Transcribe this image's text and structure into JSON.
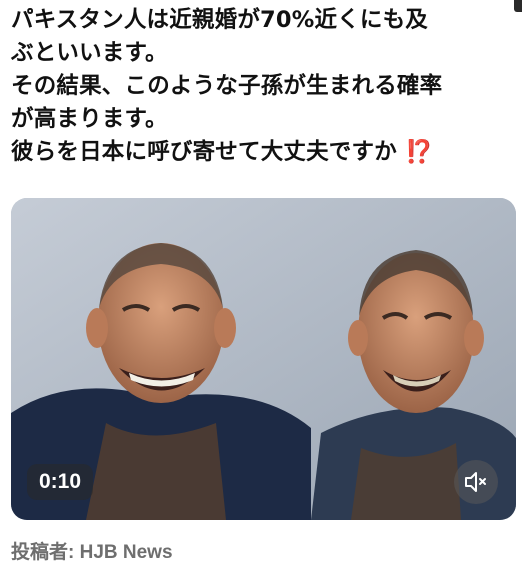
{
  "post": {
    "lines": [
      "パキスタン人は近親婚が70%近くにも及",
      "ぶといいます。",
      "その結果、このような子孫が生まれる確率",
      "が高まります。",
      "彼らを日本に呼び寄せて大丈夫ですか"
    ],
    "alert_emoji": "⁉️"
  },
  "video": {
    "duration": "0:10",
    "muted": true,
    "mute_icon": "speaker-muted-icon"
  },
  "byline": {
    "text": "投稿者: HJB News"
  },
  "colors": {
    "text": "#111111",
    "byline": "#6e6e6e",
    "alert": "#e0262b",
    "badge_bg": "rgba(40,40,40,0.55)"
  }
}
